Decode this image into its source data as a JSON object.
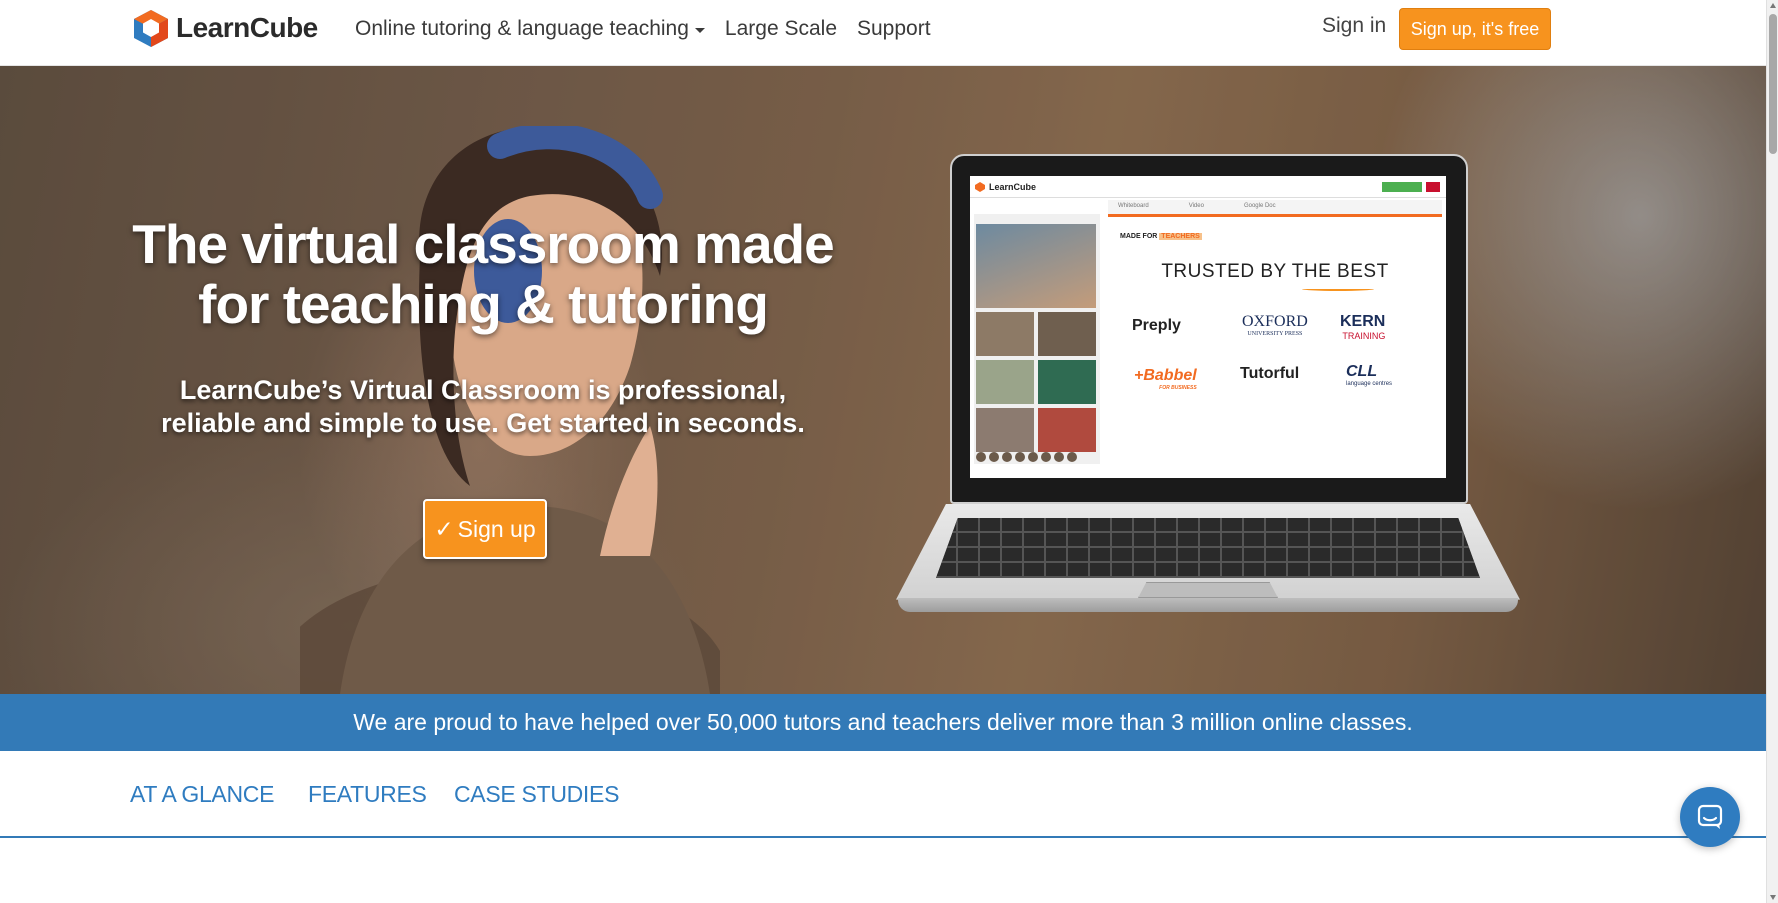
{
  "nav": {
    "logo_text": "LearnCube",
    "links": [
      {
        "label": "Online tutoring & language teaching",
        "has_dropdown": true
      },
      {
        "label": "Large Scale"
      },
      {
        "label": "Support"
      }
    ],
    "sign_in": "Sign in",
    "signup": "Sign up, it's free"
  },
  "hero": {
    "title": "The virtual classroom made for teaching & tutoring",
    "subtitle": "LearnCube’s Virtual Classroom is professional, reliable and simple to use. Get started in seconds.",
    "cta_check": "✓",
    "cta_label": "Sign up"
  },
  "laptop_screen": {
    "app_name": "LearnCube",
    "tabs": [
      "Whiteboard",
      "Video",
      "Google Doc"
    ],
    "made_for_prefix": "MADE FOR",
    "made_for_word": "TEACHERS",
    "trusted_heading": "TRUSTED BY THE BEST",
    "brands": [
      "Preply",
      "OXFORD",
      "KERN",
      "+Babbel",
      "Tutorful",
      "CLL"
    ],
    "brand_sublabels": {
      "OXFORD": "UNIVERSITY PRESS",
      "KERN": "TRAINING",
      "+Babbel": "FOR BUSINESS",
      "CLL": "language centres"
    }
  },
  "stats": {
    "text": "We are proud to have helped over 50,000 tutors and teachers deliver more than 3 million online classes."
  },
  "section_tabs": [
    "AT A GLANCE",
    "FEATURES",
    "CASE STUDIES"
  ],
  "colors": {
    "accent_orange": "#f7931e",
    "brand_blue": "#337ab7",
    "tab_blue": "#2f7cc0"
  },
  "icons": {
    "logo": "learncube-cube-icon",
    "nav_caret": "chevron-down-icon",
    "chat": "chat-bubble-icon"
  }
}
